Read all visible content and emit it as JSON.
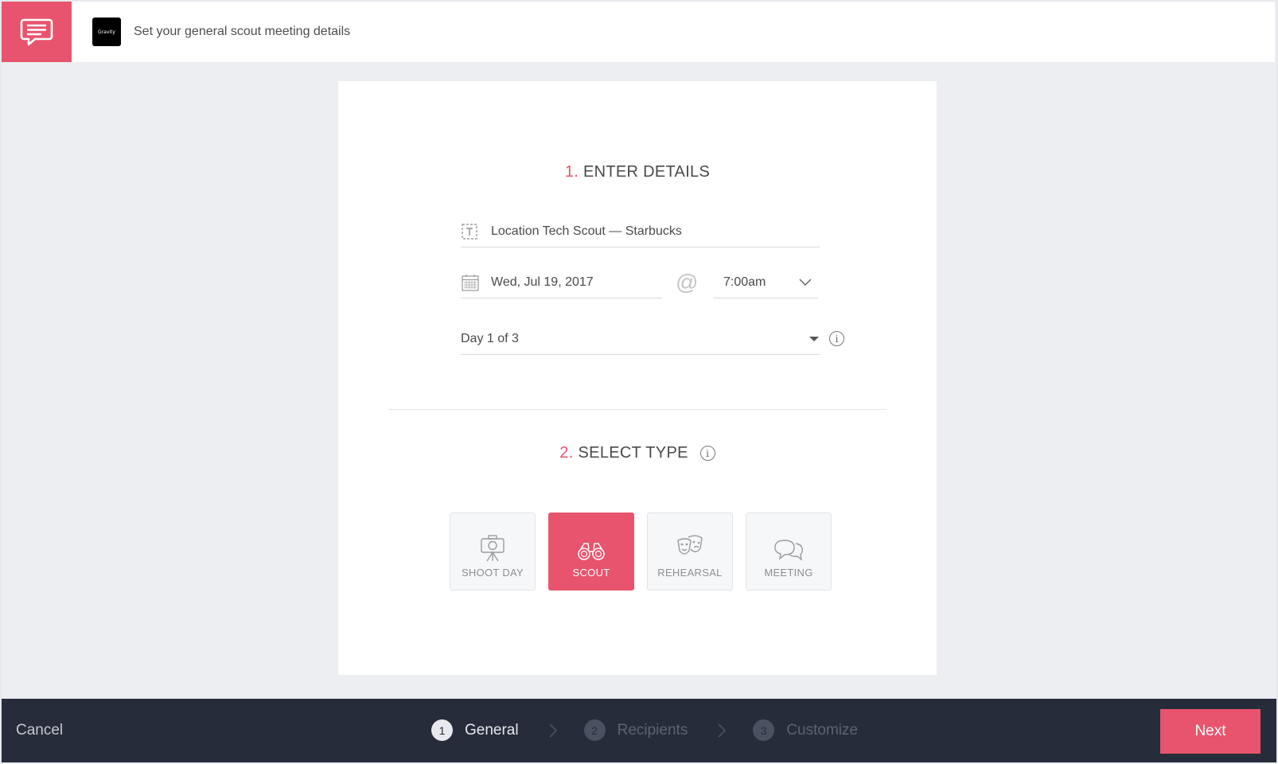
{
  "header": {
    "title": "Set your general scout meeting details",
    "brand_label": "Gravity",
    "accent_color": "#e8546d"
  },
  "details": {
    "section_number": "1.",
    "section_title": "ENTER DETAILS",
    "title_value": "Location Tech Scout — Starbucks",
    "date_value": "Wed, Jul 19, 2017",
    "at_symbol": "@",
    "time_value": "7:00am",
    "day_value": "Day 1 of 3",
    "info_glyph": "i"
  },
  "type_section": {
    "section_number": "2.",
    "section_title": "SELECT TYPE",
    "info_glyph": "i",
    "types": [
      {
        "label": "SHOOT DAY",
        "icon": "camera-tripod-icon",
        "selected": false
      },
      {
        "label": "SCOUT",
        "icon": "binoculars-icon",
        "selected": true
      },
      {
        "label": "REHEARSAL",
        "icon": "theater-masks-icon",
        "selected": false
      },
      {
        "label": "MEETING",
        "icon": "chat-bubbles-icon",
        "selected": false
      }
    ]
  },
  "footer": {
    "cancel_label": "Cancel",
    "steps": [
      {
        "num": "1",
        "label": "General",
        "active": true
      },
      {
        "num": "2",
        "label": "Recipients",
        "active": false
      },
      {
        "num": "3",
        "label": "Customize",
        "active": false
      }
    ],
    "next_label": "Next"
  }
}
